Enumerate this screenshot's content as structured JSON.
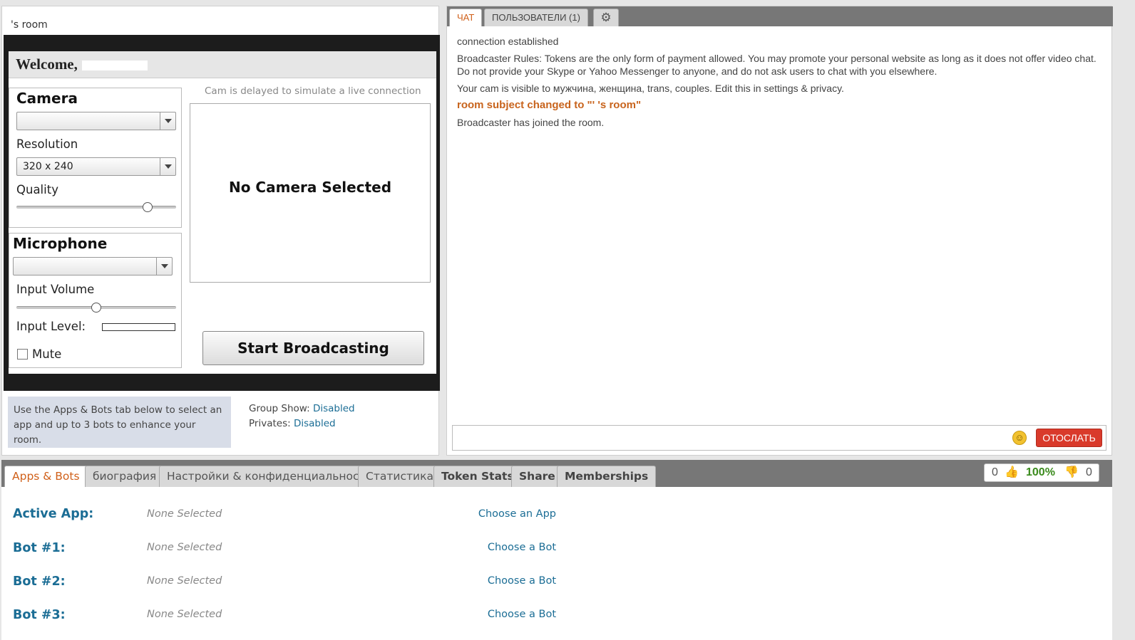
{
  "room": {
    "title": "'s room"
  },
  "broadcast": {
    "welcome": "Welcome,",
    "camera": {
      "heading": "Camera",
      "selected": "",
      "resolution_label": "Resolution",
      "resolution_value": "320 x 240",
      "quality_label": "Quality",
      "quality_level": 0.82
    },
    "microphone": {
      "heading": "Microphone",
      "selected": "",
      "input_volume_label": "Input Volume",
      "input_volume_level": 0.5,
      "input_level_label": "Input Level:",
      "mute_label": "Mute"
    },
    "delay_note": "Cam is delayed to simulate a live connection",
    "no_camera": "No Camera Selected",
    "start_button": "Start Broadcasting"
  },
  "apps_hint": "Use the Apps & Bots tab below to select an app and up to 3 bots to enhance your room.",
  "show_info": {
    "group_label": "Group Show:",
    "group_value": "Disabled",
    "privates_label": "Privates:",
    "privates_value": "Disabled"
  },
  "chat": {
    "tabs": {
      "chat": "ЧАТ",
      "users": "ПОЛЬЗОВАТЕЛИ (1)"
    },
    "messages": [
      "connection established",
      "Broadcaster Rules: Tokens are the only form of payment allowed. You may promote your personal website as long as it does not offer video chat. Do not provide your Skype or Yahoo Messenger to anyone, and do not ask users to chat with you elsewhere.",
      "Your cam is visible to мужчина, женщина, trans, couples. Edit this in settings & privacy.",
      "room subject changed to \"' 's room\"",
      "Broadcaster has joined the room."
    ],
    "input_placeholder": "",
    "send_label": "ОТОСЛАТЬ"
  },
  "bottom_tabs": [
    "Apps & Bots",
    "биография",
    "Настройки & конфиденциальность",
    "Статистика",
    "Token Stats",
    "Share",
    "Memberships"
  ],
  "rating": {
    "up": "0",
    "percent": "100%",
    "down": "0",
    "percent_color": "#3a8a1c"
  },
  "apps": {
    "rows": [
      {
        "label": "Active App:",
        "value": "None Selected",
        "action": "Choose an App"
      },
      {
        "label": "Bot #1:",
        "value": "None Selected",
        "action": "Choose a Bot"
      },
      {
        "label": "Bot #2:",
        "value": "None Selected",
        "action": "Choose a Bot"
      },
      {
        "label": "Bot #3:",
        "value": "None Selected",
        "action": "Choose a Bot"
      }
    ]
  },
  "colors": {
    "accent": "#d0601a",
    "link": "#1b6d95",
    "send": "#d93a2b"
  }
}
